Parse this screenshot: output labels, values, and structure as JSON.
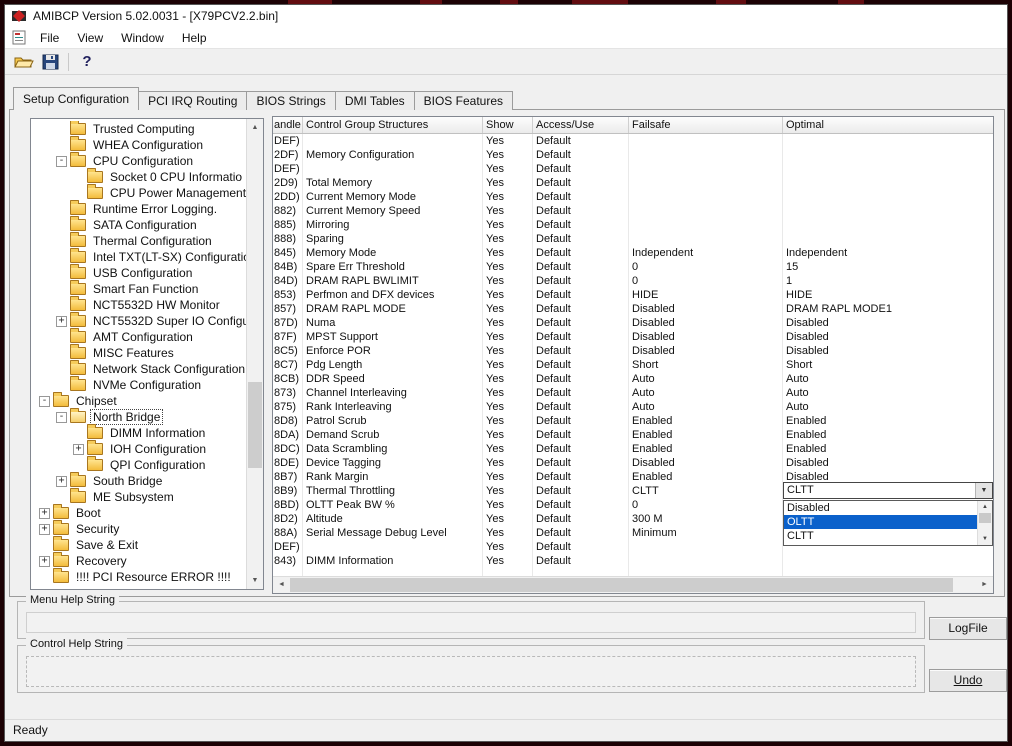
{
  "colors": {
    "desktop_bg": "#1c0104",
    "window_bg": "#f0f0f0",
    "titlebar_bg": "#ffffff",
    "selection_blue": "#0b61cb",
    "folder_yellow": "#f3bc3c"
  },
  "window": {
    "title": "AMIBCP Version 5.02.0031 - [X79PCV2.2.bin]",
    "menus": [
      "File",
      "View",
      "Window",
      "Help"
    ],
    "toolbar_icons": [
      "open-file",
      "save-file",
      "help"
    ],
    "tabs": [
      "Setup Configuration",
      "PCI IRQ Routing",
      "BIOS Strings",
      "DMI Tables",
      "BIOS Features"
    ],
    "active_tab": "Setup Configuration",
    "status": "Ready"
  },
  "tree": {
    "items": [
      {
        "label": "Trusted Computing",
        "level": 1,
        "expander": "none"
      },
      {
        "label": "WHEA Configuration",
        "level": 1,
        "expander": "none"
      },
      {
        "label": "CPU Configuration",
        "level": 1,
        "expander": "minus"
      },
      {
        "label": "Socket 0 CPU Informatio",
        "level": 2,
        "expander": "none"
      },
      {
        "label": "CPU Power Management",
        "level": 2,
        "expander": "none"
      },
      {
        "label": "Runtime Error Logging.",
        "level": 1,
        "expander": "none"
      },
      {
        "label": "SATA Configuration",
        "level": 1,
        "expander": "none"
      },
      {
        "label": "Thermal Configuration",
        "level": 1,
        "expander": "none"
      },
      {
        "label": "Intel TXT(LT-SX) Configuratio",
        "level": 1,
        "expander": "none"
      },
      {
        "label": "USB Configuration",
        "level": 1,
        "expander": "none"
      },
      {
        "label": "Smart Fan Function",
        "level": 1,
        "expander": "none"
      },
      {
        "label": "NCT5532D HW Monitor",
        "level": 1,
        "expander": "none"
      },
      {
        "label": "NCT5532D Super IO Configu",
        "level": 1,
        "expander": "plus"
      },
      {
        "label": "AMT Configuration",
        "level": 1,
        "expander": "none"
      },
      {
        "label": "MISC Features",
        "level": 1,
        "expander": "none"
      },
      {
        "label": "Network Stack Configuration",
        "level": 1,
        "expander": "none"
      },
      {
        "label": "NVMe Configuration",
        "level": 1,
        "expander": "none"
      },
      {
        "label": "Chipset",
        "level": 0,
        "expander": "minus"
      },
      {
        "label": "North Bridge",
        "level": 1,
        "expander": "minus",
        "open": true,
        "selected": true
      },
      {
        "label": "DIMM Information",
        "level": 2,
        "expander": "none"
      },
      {
        "label": "IOH Configuration",
        "level": 2,
        "expander": "plus"
      },
      {
        "label": "QPI Configuration",
        "level": 2,
        "expander": "none"
      },
      {
        "label": "South Bridge",
        "level": 1,
        "expander": "plus"
      },
      {
        "label": "ME Subsystem",
        "level": 1,
        "expander": "none"
      },
      {
        "label": "Boot",
        "level": 0,
        "expander": "plus"
      },
      {
        "label": "Security",
        "level": 0,
        "expander": "plus"
      },
      {
        "label": "Save & Exit",
        "level": 0,
        "expander": "none"
      },
      {
        "label": "Recovery",
        "level": 0,
        "expander": "plus"
      },
      {
        "label": "!!!! PCI Resource ERROR !!!!",
        "level": 0,
        "expander": "none"
      }
    ]
  },
  "table": {
    "columns": [
      "andle",
      "Control Group Structures",
      "Show",
      "Access/Use",
      "Failsafe",
      "Optimal"
    ],
    "rows": [
      {
        "handle": "DEF)",
        "name": "",
        "show": "Yes",
        "access": "Default",
        "failsafe": "",
        "optimal": ""
      },
      {
        "handle": "2DF)",
        "name": "Memory Configuration",
        "show": "Yes",
        "access": "Default",
        "failsafe": "",
        "optimal": ""
      },
      {
        "handle": "DEF)",
        "name": "",
        "show": "Yes",
        "access": "Default",
        "failsafe": "",
        "optimal": ""
      },
      {
        "handle": "2D9)",
        "name": "Total Memory",
        "show": "Yes",
        "access": "Default",
        "failsafe": "",
        "optimal": ""
      },
      {
        "handle": "2DD)",
        "name": "Current Memory Mode",
        "show": "Yes",
        "access": "Default",
        "failsafe": "",
        "optimal": ""
      },
      {
        "handle": "882)",
        "name": "Current Memory Speed",
        "show": "Yes",
        "access": "Default",
        "failsafe": "",
        "optimal": ""
      },
      {
        "handle": "885)",
        "name": "Mirroring",
        "show": "Yes",
        "access": "Default",
        "failsafe": "",
        "optimal": ""
      },
      {
        "handle": "888)",
        "name": "Sparing",
        "show": "Yes",
        "access": "Default",
        "failsafe": "",
        "optimal": ""
      },
      {
        "handle": "845)",
        "name": "Memory Mode",
        "show": "Yes",
        "access": "Default",
        "failsafe": "Independent",
        "optimal": "Independent"
      },
      {
        "handle": "84B)",
        "name": "Spare Err Threshold",
        "show": "Yes",
        "access": "Default",
        "failsafe": "0",
        "optimal": "15"
      },
      {
        "handle": "84D)",
        "name": "DRAM RAPL BWLIMIT",
        "show": "Yes",
        "access": "Default",
        "failsafe": "0",
        "optimal": "1"
      },
      {
        "handle": "853)",
        "name": "Perfmon and DFX devices",
        "show": "Yes",
        "access": "Default",
        "failsafe": "HIDE",
        "optimal": "HIDE"
      },
      {
        "handle": "857)",
        "name": "DRAM RAPL MODE",
        "show": "Yes",
        "access": "Default",
        "failsafe": "Disabled",
        "optimal": "DRAM RAPL MODE1"
      },
      {
        "handle": "87D)",
        "name": "Numa",
        "show": "Yes",
        "access": "Default",
        "failsafe": "Disabled",
        "optimal": "Disabled"
      },
      {
        "handle": "87F)",
        "name": "MPST Support",
        "show": "Yes",
        "access": "Default",
        "failsafe": "Disabled",
        "optimal": "Disabled"
      },
      {
        "handle": "8C5)",
        "name": "Enforce POR",
        "show": "Yes",
        "access": "Default",
        "failsafe": "Disabled",
        "optimal": "Disabled"
      },
      {
        "handle": "8C7)",
        "name": "Pdg Length",
        "show": "Yes",
        "access": "Default",
        "failsafe": "Short",
        "optimal": "Short"
      },
      {
        "handle": "8CB)",
        "name": "DDR Speed",
        "show": "Yes",
        "access": "Default",
        "failsafe": "Auto",
        "optimal": "Auto"
      },
      {
        "handle": "873)",
        "name": "Channel Interleaving",
        "show": "Yes",
        "access": "Default",
        "failsafe": "Auto",
        "optimal": "Auto"
      },
      {
        "handle": "875)",
        "name": "Rank Interleaving",
        "show": "Yes",
        "access": "Default",
        "failsafe": "Auto",
        "optimal": "Auto"
      },
      {
        "handle": "8D8)",
        "name": "Patrol Scrub",
        "show": "Yes",
        "access": "Default",
        "failsafe": "Enabled",
        "optimal": "Enabled"
      },
      {
        "handle": "8DA)",
        "name": "Demand Scrub",
        "show": "Yes",
        "access": "Default",
        "failsafe": "Enabled",
        "optimal": "Enabled"
      },
      {
        "handle": "8DC)",
        "name": "Data Scrambling",
        "show": "Yes",
        "access": "Default",
        "failsafe": "Enabled",
        "optimal": "Enabled"
      },
      {
        "handle": "8DE)",
        "name": "Device Tagging",
        "show": "Yes",
        "access": "Default",
        "failsafe": "Disabled",
        "optimal": "Disabled"
      },
      {
        "handle": "8B7)",
        "name": "Rank Margin",
        "show": "Yes",
        "access": "Default",
        "failsafe": "Enabled",
        "optimal": "Disabled"
      },
      {
        "handle": "8B9)",
        "name": "Thermal Throttling",
        "show": "Yes",
        "access": "Default",
        "failsafe": "CLTT",
        "optimal": ""
      },
      {
        "handle": "8BD)",
        "name": "OLTT Peak BW %",
        "show": "Yes",
        "access": "Default",
        "failsafe": "0",
        "optimal": ""
      },
      {
        "handle": "8D2)",
        "name": "Altitude",
        "show": "Yes",
        "access": "Default",
        "failsafe": "300 M",
        "optimal": ""
      },
      {
        "handle": "88A)",
        "name": "Serial Message Debug Level",
        "show": "Yes",
        "access": "Default",
        "failsafe": "Minimum",
        "optimal": ""
      },
      {
        "handle": "DEF)",
        "name": "",
        "show": "Yes",
        "access": "Default",
        "failsafe": "",
        "optimal": ""
      },
      {
        "handle": "843)",
        "name": "DIMM Information",
        "show": "Yes",
        "access": "Default",
        "failsafe": "",
        "optimal": ""
      }
    ]
  },
  "dropdown": {
    "value": "CLTT",
    "options": [
      {
        "label": "Disabled",
        "highlighted": false
      },
      {
        "label": "OLTT",
        "highlighted": true
      },
      {
        "label": "CLTT",
        "highlighted": false
      }
    ]
  },
  "help_panels": {
    "menu_label": "Menu Help String",
    "control_label": "Control Help String"
  },
  "buttons": {
    "logfile": "LogFile",
    "undo": "Undo"
  }
}
